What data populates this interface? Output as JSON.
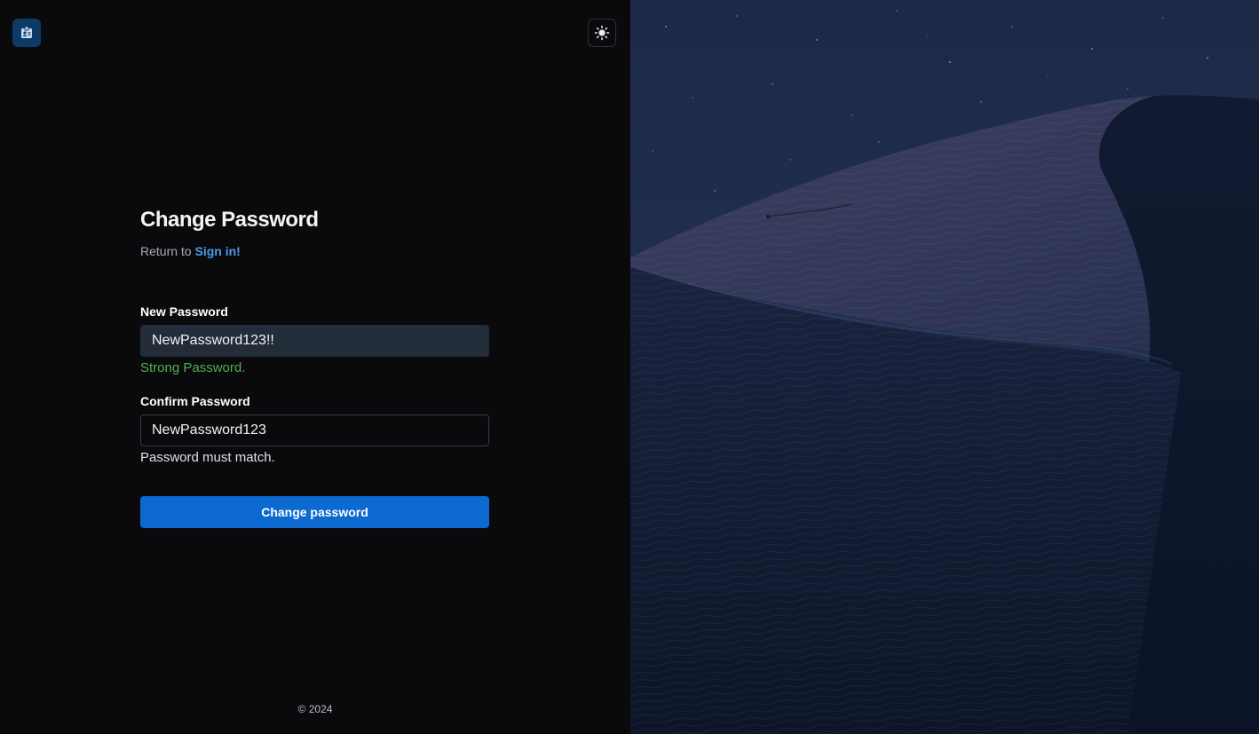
{
  "header": {
    "logo_icon": "id-badge-icon",
    "theme_toggle_icon": "sun-icon"
  },
  "form": {
    "title": "Change Password",
    "subtitle_prefix": "Return to",
    "signin_link": "Sign in!",
    "new_password": {
      "label": "New Password",
      "value": "NewPassword123!!",
      "hint": "Strong Password."
    },
    "confirm_password": {
      "label": "Confirm Password",
      "value": "NewPassword123",
      "hint": "Password must match."
    },
    "submit_label": "Change password"
  },
  "footer": {
    "copyright": "© 2024"
  },
  "colors": {
    "accent": "#0b69cf",
    "link": "#4a9ae8",
    "success": "#4bb24f",
    "background": "#0a0a0c"
  }
}
